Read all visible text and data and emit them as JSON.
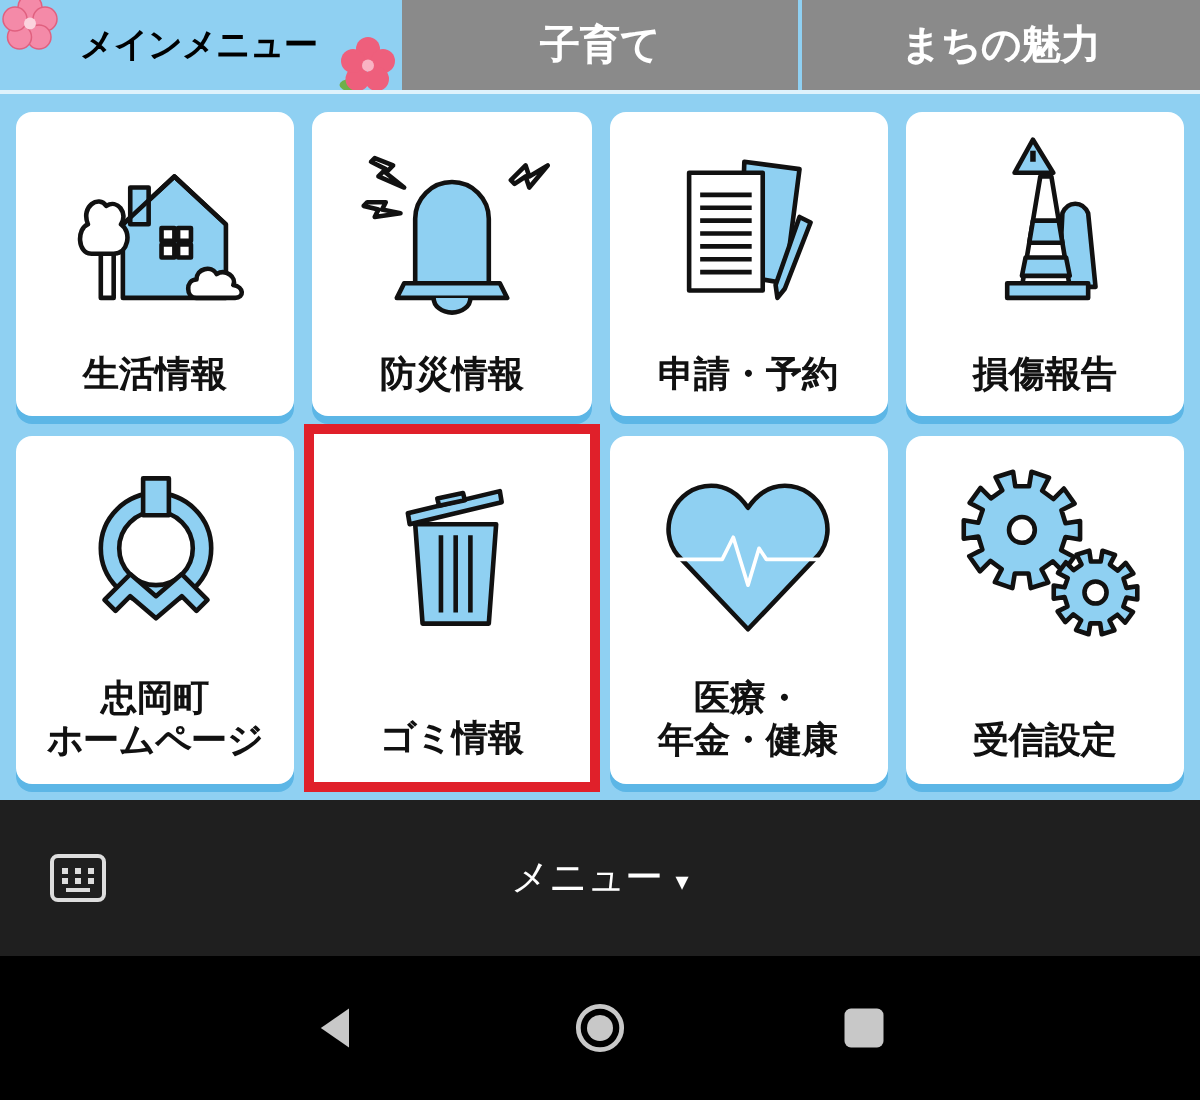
{
  "tabs": [
    {
      "label": "メインメニュー",
      "selected": true
    },
    {
      "label": "子育て",
      "selected": false
    },
    {
      "label": "まちの魅力",
      "selected": false
    }
  ],
  "tiles": [
    {
      "lines": [
        "生活情報"
      ],
      "selected": false
    },
    {
      "lines": [
        "防災情報"
      ],
      "selected": false
    },
    {
      "lines": [
        "申請・予約"
      ],
      "selected": false
    },
    {
      "lines": [
        "損傷報告"
      ],
      "selected": false
    },
    {
      "lines": [
        "忠岡町",
        "ホームページ"
      ],
      "selected": false
    },
    {
      "lines": [
        "ゴミ情報"
      ],
      "selected": true
    },
    {
      "lines": [
        "医療・",
        "年金・健康"
      ],
      "selected": false
    },
    {
      "lines": [
        "受信設定"
      ],
      "selected": false
    }
  ],
  "bottom_bar": {
    "menu_label": "メニュー",
    "caret": "▾"
  }
}
